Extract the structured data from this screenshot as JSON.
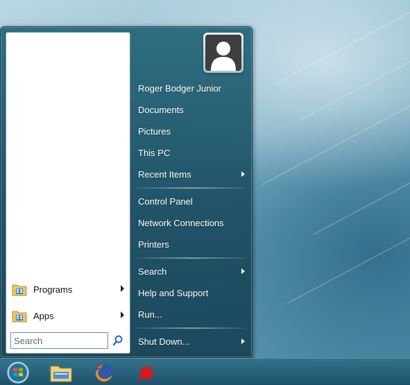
{
  "left_pane": {
    "items": [
      {
        "label": "Programs",
        "icon": "folder-icon",
        "has_submenu": true
      },
      {
        "label": "Apps",
        "icon": "folder-icon",
        "has_submenu": true
      }
    ],
    "search": {
      "placeholder": "Search",
      "value": ""
    }
  },
  "user": {
    "avatar_icon": "user-avatar-icon"
  },
  "right_pane": {
    "group1": [
      {
        "label": "Roger Bodger Junior",
        "submenu": false
      },
      {
        "label": "Documents",
        "submenu": false
      },
      {
        "label": "Pictures",
        "submenu": false
      },
      {
        "label": "This PC",
        "submenu": false
      },
      {
        "label": "Recent Items",
        "submenu": true
      }
    ],
    "group2": [
      {
        "label": "Control Panel",
        "submenu": false
      },
      {
        "label": "Network Connections",
        "submenu": false
      },
      {
        "label": "Printers",
        "submenu": false
      }
    ],
    "group3": [
      {
        "label": "Search",
        "submenu": true
      },
      {
        "label": "Help and Support",
        "submenu": false
      },
      {
        "label": "Run...",
        "submenu": false
      }
    ],
    "group4": [
      {
        "label": "Shut Down...",
        "submenu": true
      }
    ]
  },
  "taskbar": {
    "items": [
      {
        "icon": "start-orb-icon"
      },
      {
        "icon": "file-explorer-icon"
      },
      {
        "icon": "firefox-icon"
      },
      {
        "icon": "red-splat-app-icon"
      }
    ]
  },
  "colors": {
    "menu_blue": "#28697d",
    "desktop": "#6aa3bb"
  }
}
